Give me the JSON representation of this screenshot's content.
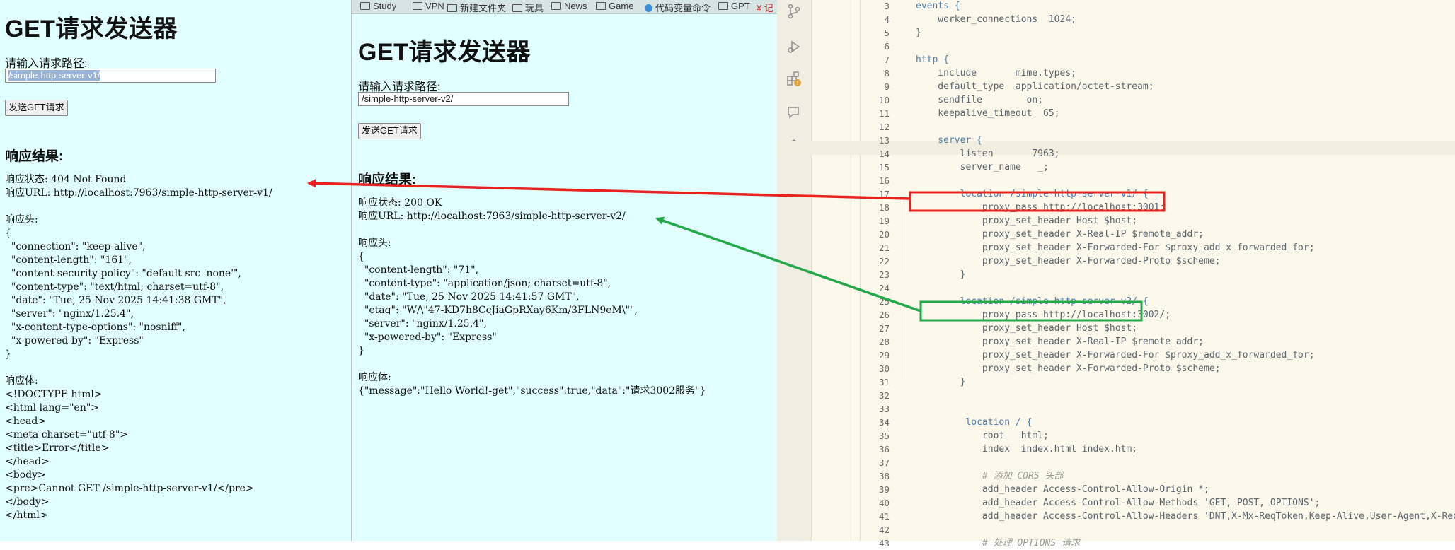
{
  "left_app": {
    "title": "GET请求发送器",
    "path_label": "请输入请求路径:",
    "path_value": "/simple-http-server-v1/",
    "send_button": "发送GET请求",
    "result_heading": "响应结果:",
    "response_text": "响应状态: 404 Not Found\n响应URL: http://localhost:7963/simple-http-server-v1/\n\n响应头:\n{\n  \"connection\": \"keep-alive\",\n  \"content-length\": \"161\",\n  \"content-security-policy\": \"default-src 'none'\",\n  \"content-type\": \"text/html; charset=utf-8\",\n  \"date\": \"Tue, 25 Nov 2025 14:41:38 GMT\",\n  \"server\": \"nginx/1.25.4\",\n  \"x-content-type-options\": \"nosniff\",\n  \"x-powered-by\": \"Express\"\n}\n\n响应体:\n<!DOCTYPE html>\n<html lang=\"en\">\n<head>\n<meta charset=\"utf-8\">\n<title>Error</title>\n</head>\n<body>\n<pre>Cannot GET /simple-http-server-v1/</pre>\n</body>\n</html>"
  },
  "bookmarks": [
    "Study",
    "VPN",
    "新建文件夹",
    "玩具",
    "News",
    "Game",
    "代码变量命令",
    "GPT",
    "¥ 记"
  ],
  "right_app": {
    "title": "GET请求发送器",
    "path_label": "请输入请求路径:",
    "path_value": "/simple-http-server-v2/",
    "send_button": "发送GET请求",
    "result_heading": "响应结果:",
    "response_text": "响应状态: 200 OK\n响应URL: http://localhost:7963/simple-http-server-v2/\n\n响应头:\n{\n  \"content-length\": \"71\",\n  \"content-type\": \"application/json; charset=utf-8\",\n  \"date\": \"Tue, 25 Nov 2025 14:41:57 GMT\",\n  \"etag\": \"W/\\\"47-KD7h8CcJiaGpRXay6Km/3FLN9eM\\\"\",\n  \"server\": \"nginx/1.25.4\",\n  \"x-powered-by\": \"Express\"\n}\n\n响应体:\n{\"message\":\"Hello World!-get\",\"success\":true,\"data\":\"请求3002服务\"}"
  },
  "editor": {
    "activity_icons": [
      "source-control-icon",
      "run-debug-icon",
      "extensions-warning-icon",
      "remote-explorer-icon",
      "testing-icon"
    ],
    "lines": [
      {
        "n": "3",
        "t": "events {"
      },
      {
        "n": "4",
        "t": "    worker_connections  1024;"
      },
      {
        "n": "5",
        "t": "}"
      },
      {
        "n": "6",
        "t": ""
      },
      {
        "n": "7",
        "t": "http {"
      },
      {
        "n": "8",
        "t": "    include       mime.types;"
      },
      {
        "n": "9",
        "t": "    default_type  application/octet-stream;"
      },
      {
        "n": "10",
        "t": "    sendfile        on;"
      },
      {
        "n": "11",
        "t": "    keepalive_timeout  65;"
      },
      {
        "n": "12",
        "t": ""
      },
      {
        "n": "13",
        "t": "    server {"
      },
      {
        "n": "14",
        "t": "        listen       7963;"
      },
      {
        "n": "15",
        "t": "        server_name   _;"
      },
      {
        "n": "16",
        "t": ""
      },
      {
        "n": "17",
        "t": "        location /simple-http-server-v1/ {"
      },
      {
        "n": "18",
        "t": "            proxy_pass http://localhost:3001;"
      },
      {
        "n": "19",
        "t": "            proxy_set_header Host $host;"
      },
      {
        "n": "20",
        "t": "            proxy_set_header X-Real-IP $remote_addr;"
      },
      {
        "n": "21",
        "t": "            proxy_set_header X-Forwarded-For $proxy_add_x_forwarded_for;"
      },
      {
        "n": "22",
        "t": "            proxy_set_header X-Forwarded-Proto $scheme;"
      },
      {
        "n": "23",
        "t": "        }"
      },
      {
        "n": "24",
        "t": ""
      },
      {
        "n": "25",
        "t": "        location /simple-http-server-v2/ {"
      },
      {
        "n": "26",
        "t": "            proxy_pass http://localhost:3002/;"
      },
      {
        "n": "27",
        "t": "            proxy_set_header Host $host;"
      },
      {
        "n": "28",
        "t": "            proxy_set_header X-Real-IP $remote_addr;"
      },
      {
        "n": "29",
        "t": "            proxy_set_header X-Forwarded-For $proxy_add_x_forwarded_for;"
      },
      {
        "n": "30",
        "t": "            proxy_set_header X-Forwarded-Proto $scheme;"
      },
      {
        "n": "31",
        "t": "        }"
      },
      {
        "n": "32",
        "t": ""
      },
      {
        "n": "33",
        "t": ""
      },
      {
        "n": "34",
        "t": "         location / {"
      },
      {
        "n": "35",
        "t": "            root   html;"
      },
      {
        "n": "36",
        "t": "            index  index.html index.htm;"
      },
      {
        "n": "37",
        "t": ""
      },
      {
        "n": "38",
        "t": "            # 添加 CORS 头部"
      },
      {
        "n": "39",
        "t": "            add_header Access-Control-Allow-Origin *;"
      },
      {
        "n": "40",
        "t": "            add_header Access-Control-Allow-Methods 'GET, POST, OPTIONS';"
      },
      {
        "n": "41",
        "t": "            add_header Access-Control-Allow-Headers 'DNT,X-Mx-ReqToken,Keep-Alive,User-Agent,X-Requested-With,"
      },
      {
        "n": "42",
        "t": ""
      },
      {
        "n": "43",
        "t": "            # 处理 OPTIONS 请求"
      }
    ]
  },
  "annotations": {
    "red_color": "#e8231f",
    "green_color": "#23a94a"
  }
}
